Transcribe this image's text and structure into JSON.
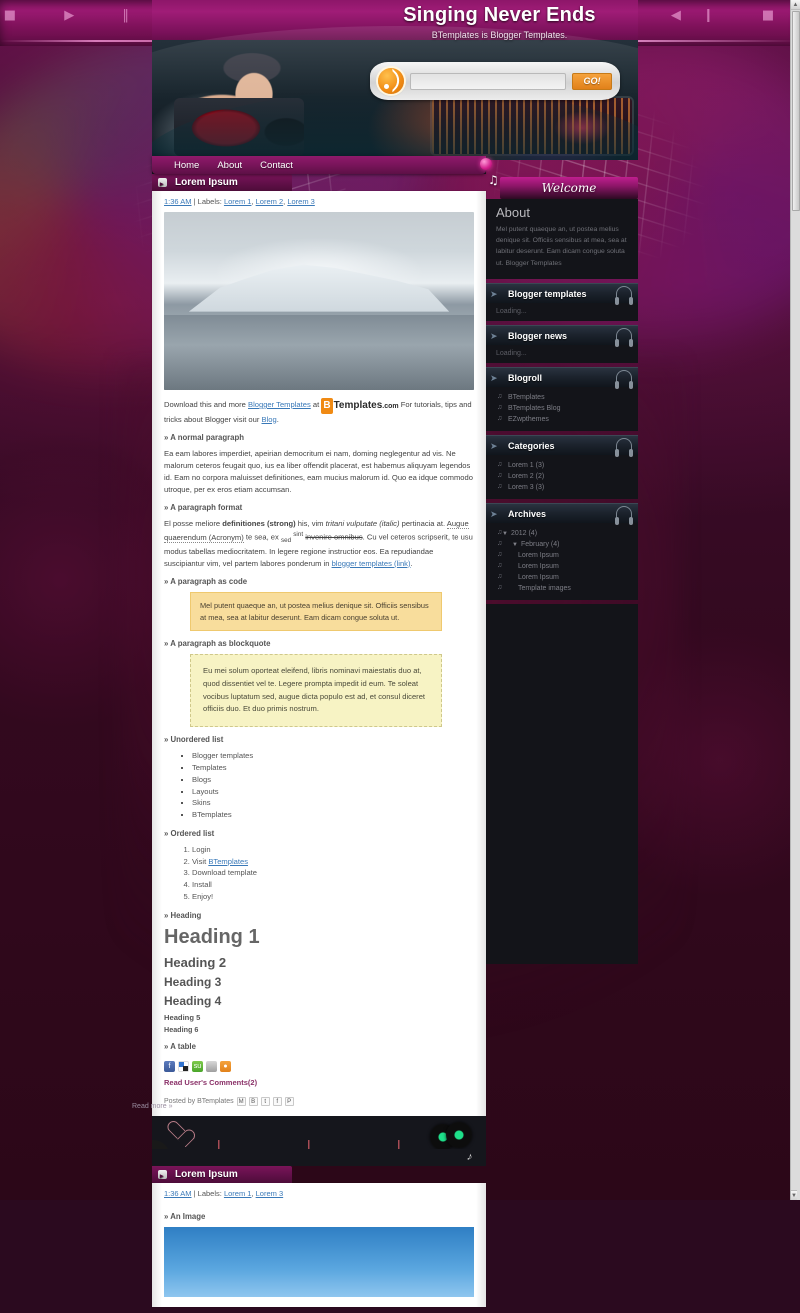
{
  "site": {
    "title": "Singing Never Ends",
    "tagline": "BTemplates is Blogger Templates."
  },
  "search": {
    "value": "",
    "placeholder": "",
    "go_label": "GO!",
    "rss_icon": "rss-icon"
  },
  "nav": {
    "items": [
      {
        "label": "Home"
      },
      {
        "label": "About"
      },
      {
        "label": "Contact"
      }
    ]
  },
  "posts": [
    {
      "title": "Lorem Ipsum",
      "time": "1:36 AM",
      "labels_prefix": "| Labels:",
      "labels": [
        "Lorem 1",
        "Lorem 2",
        "Lorem 3"
      ],
      "intro": {
        "before": "Download this and more ",
        "link1": "Blogger Templates",
        "at": " at ",
        "logo_b": "B",
        "logo_name": "Templates",
        "logo_com": ".com",
        "after": " For tutorials, tips and tricks about Blogger visit our ",
        "link2": "Blog",
        "end": "."
      },
      "sections": {
        "normal_paragraph": "» A normal paragraph",
        "paragraph_format": "» A paragraph format",
        "paragraph_code": "» A paragraph as code",
        "paragraph_blockquote": "» A paragraph as blockquote",
        "unordered_list": "» Unordered list",
        "ordered_list": "» Ordered list",
        "heading": "» Heading",
        "a_table": "» A table"
      },
      "normal_text": "Ea eam labores imperdiet, apeirian democritum ei nam, doming neglegentur ad vis. Ne malorum ceteros feugait quo, ius ea liber offendit placerat, est habemus aliquyam legendos id. Eam no corpora maluisset definitiones, eam mucius malorum id. Quo ea idque commodo utroque, per ex eros etiam accumsan.",
      "format_text": {
        "p1": "El posse meliore ",
        "strong": "definitiones (strong)",
        "p2": " his, vim ",
        "italic": "tritani vulputate (italic)",
        "p3": " pertinacia at. ",
        "acronym": "Augue quaerendum (Acronym)",
        "p4": " te sea, ex ",
        "sub": "sed",
        "p5": " ",
        "sup": "sint",
        "p6": " ",
        "strike": "invenire omnibus",
        "p7": ". Cu vel ceteros scripserit, te usu modus tabellas mediocritatem. In legere regione instructior eos. Ea repudiandae suscipiantur vim, vel partem labores ponderum in ",
        "link": "blogger templates (link)",
        "p8": "."
      },
      "code_text": "Mel putent quaeque an, ut postea melius denique sit. Officiis sensibus at mea, sea at labitur deserunt. Eam dicam congue soluta ut.",
      "quote_text": "Eu mei solum oporteat eleifend, libris nominavi maiestatis duo at, quod dissentiet vel te. Legere prompta impedit id eum. Te soleat vocibus luptatum sed, augue dicta populo est ad, et consul diceret officiis duo. Et duo primis nostrum.",
      "ul_items": [
        "Blogger templates",
        "Templates",
        "Blogs",
        "Layouts",
        "Skins",
        "BTemplates"
      ],
      "ol_items": [
        {
          "text": "Login"
        },
        {
          "text": "Visit ",
          "link": "BTemplates"
        },
        {
          "text": "Download template"
        },
        {
          "text": "Install"
        },
        {
          "text": "Enjoy!"
        }
      ],
      "headings": {
        "h1": "Heading 1",
        "h2": "Heading 2",
        "h3": "Heading 3",
        "h4": "Heading 4",
        "h5": "Heading 5",
        "h6": "Heading 6"
      },
      "share_icons": [
        "facebook-icon",
        "delicious-icon",
        "stumbleupon-icon",
        "digg-icon",
        "rss-icon"
      ],
      "comments": "Read User's Comments(2)",
      "posted_by": "Posted by BTemplates",
      "posted_icons": [
        "gmail-icon",
        "blogger-icon",
        "twitter-icon",
        "facebook-icon",
        "pinterest-icon"
      ],
      "read_more": "Read more »"
    },
    {
      "title": "Lorem Ipsum",
      "time": "1:36 AM",
      "labels_prefix": "| Labels:",
      "labels": [
        "Lorem 1",
        "Lorem 3"
      ],
      "sections": {
        "an_image": "» An Image"
      }
    }
  ],
  "sidebar": {
    "welcome": "Welcome",
    "about": {
      "heading": "About",
      "text": "Mel putent quaeque an, ut postea melius denique sit. Officiis sensibus at mea, sea at labitur deserunt. Eam dicam congue soluta ut. Blogger Templates"
    },
    "widgets": [
      {
        "title": "Blogger templates",
        "loading": "Loading..."
      },
      {
        "title": "Blogger news",
        "loading": "Loading..."
      },
      {
        "title": "Blogroll",
        "items": [
          "BTemplates",
          "BTemplates Blog",
          "EZwpthemes"
        ]
      },
      {
        "title": "Categories",
        "items": [
          "Lorem 1 (3)",
          "Lorem 2 (2)",
          "Lorem 3 (3)"
        ]
      },
      {
        "title": "Archives",
        "tree": [
          {
            "level": "y",
            "label": "2012 (4)",
            "tri": "▼"
          },
          {
            "level": "m",
            "label": "February (4)",
            "tri": "▼"
          },
          {
            "level": "p",
            "label": "Lorem Ipsum"
          },
          {
            "level": "p",
            "label": "Lorem Ipsum"
          },
          {
            "level": "p",
            "label": "Lorem Ipsum"
          },
          {
            "level": "p",
            "label": "Template images"
          }
        ]
      }
    ]
  },
  "decor": {
    "player_glyphs": "■ ▶ ‖ ⏪ ⏩ ❙◀ ▶❙ ‖ ⏪ ⏩ ◀❙ ■"
  },
  "colors": {
    "accent_magenta": "#8f1a6b",
    "accent_pink": "#ff3ba0",
    "panel_dark": "#131419",
    "orange": "#e1811a",
    "link_blue": "#3a79b8"
  }
}
